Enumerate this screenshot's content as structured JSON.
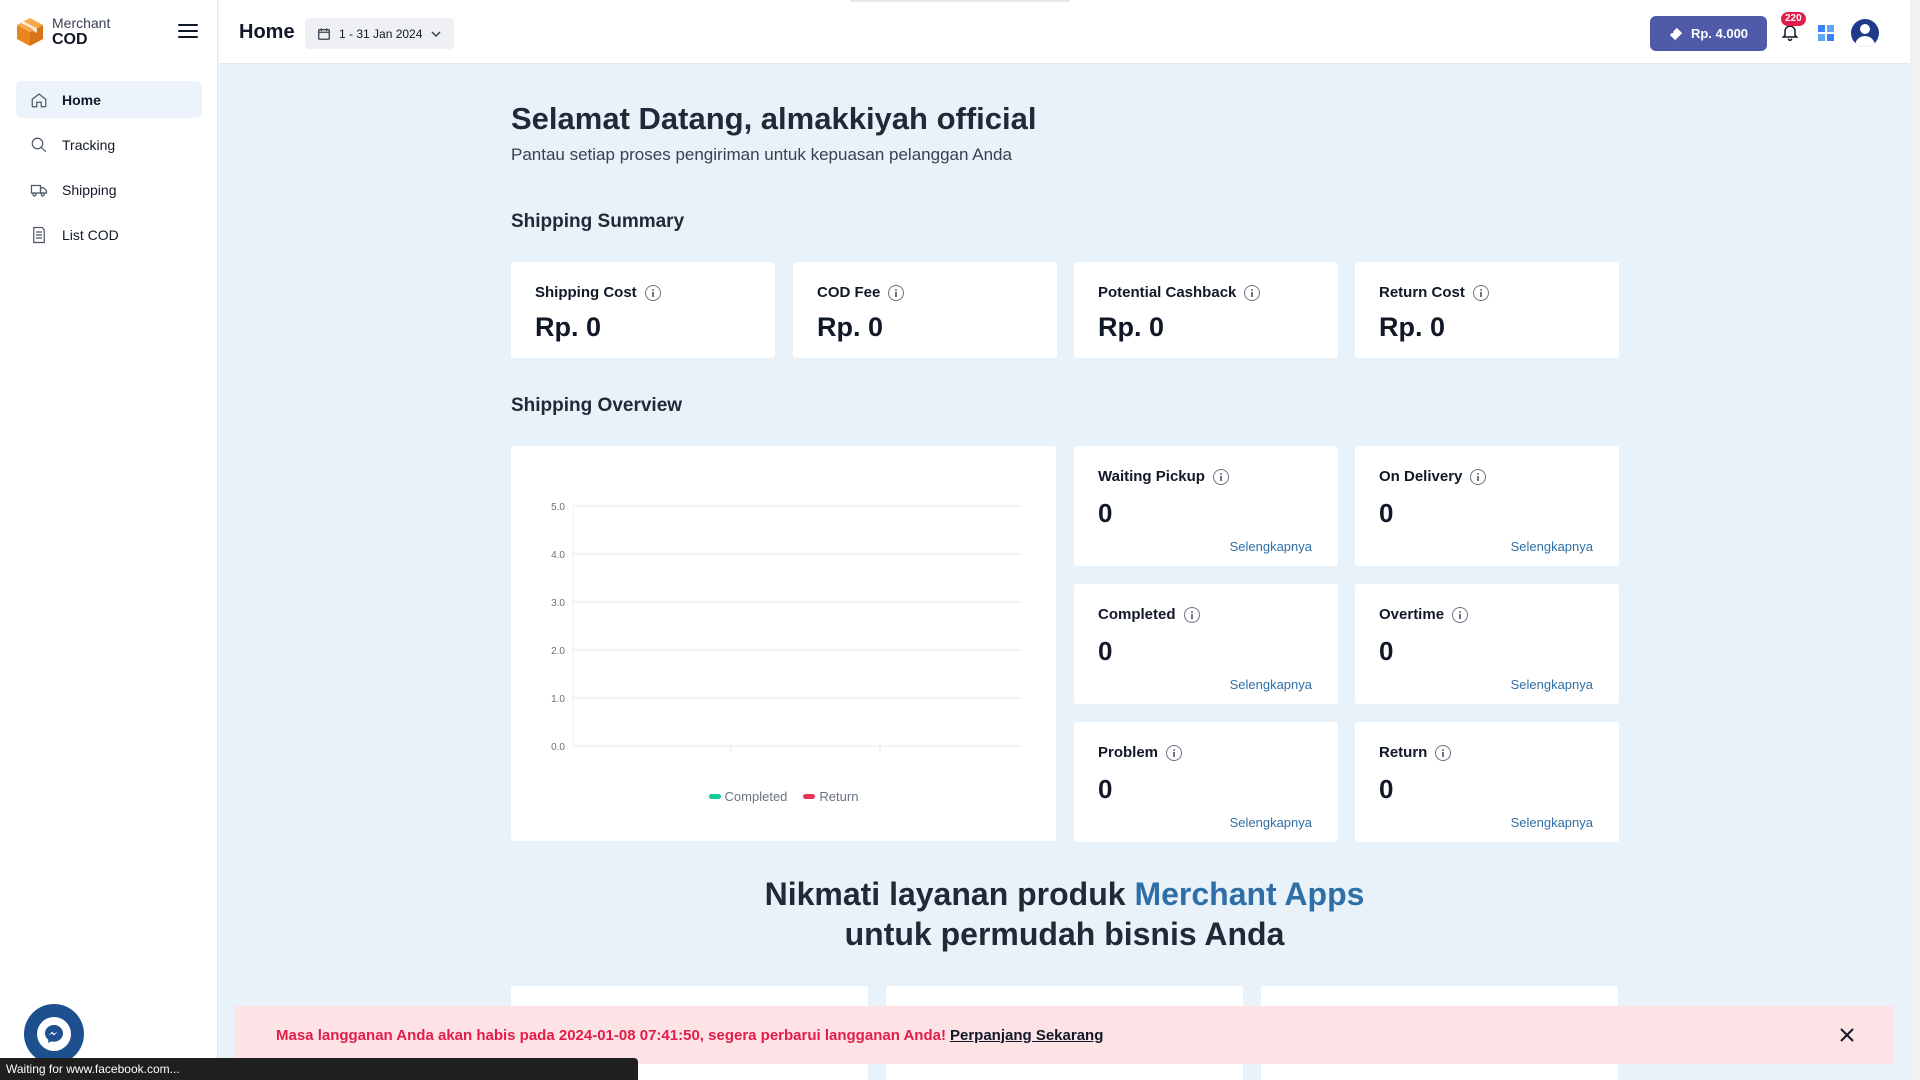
{
  "brand": {
    "top": "Merchant",
    "bottom": "COD"
  },
  "sidebar": {
    "items": [
      {
        "label": "Home",
        "icon": "home-icon"
      },
      {
        "label": "Tracking",
        "icon": "search-icon"
      },
      {
        "label": "Shipping",
        "icon": "truck-icon"
      },
      {
        "label": "List COD",
        "icon": "document-icon"
      }
    ]
  },
  "header": {
    "title": "Home",
    "date_range": "1 - 31 Jan 2024",
    "balance": "Rp. 4.000",
    "notification_count": "220"
  },
  "main": {
    "greeting": "Selamat Datang, almakkiyah official",
    "subgreeting": "Pantau setiap proses pengiriman untuk kepuasan pelanggan Anda",
    "summary_title": "Shipping Summary",
    "summary_cards": [
      {
        "label": "Shipping Cost",
        "value": "Rp. 0"
      },
      {
        "label": "COD Fee",
        "value": "Rp. 0"
      },
      {
        "label": "Potential Cashback",
        "value": "Rp. 0"
      },
      {
        "label": "Return Cost",
        "value": "Rp. 0"
      }
    ],
    "overview_title": "Shipping Overview",
    "overview_cards": [
      {
        "label": "Waiting Pickup",
        "value": "0",
        "link": "Selengkapnya"
      },
      {
        "label": "On Delivery",
        "value": "0",
        "link": "Selengkapnya"
      },
      {
        "label": "Completed",
        "value": "0",
        "link": "Selengkapnya"
      },
      {
        "label": "Overtime",
        "value": "0",
        "link": "Selengkapnya"
      },
      {
        "label": "Problem",
        "value": "0",
        "link": "Selengkapnya"
      },
      {
        "label": "Return",
        "value": "0",
        "link": "Selengkapnya"
      }
    ],
    "promo": {
      "line1_prefix": "Nikmati layanan produk",
      "line1_accent": "Merchant Apps",
      "line2": "untuk permudah bisnis Anda"
    }
  },
  "chart_data": {
    "type": "line",
    "y_ticks": [
      "5.0",
      "4.0",
      "3.0",
      "2.0",
      "1.0",
      "0.0"
    ],
    "ylim": [
      0,
      5
    ],
    "grid": true,
    "legend_position": "bottom",
    "series": [
      {
        "name": "Completed",
        "values": [],
        "color": "#10c998"
      },
      {
        "name": "Return",
        "values": [],
        "color": "#e8335c"
      }
    ]
  },
  "banner": {
    "message": "Masa langganan Anda akan habis pada 2024-01-08 07:41:50, segera perbarui langganan Anda!",
    "action": "Perpanjang Sekarang"
  },
  "statusbar": {
    "text": "Waiting for www.facebook.com..."
  },
  "colors": {
    "accent": "#4f5aa8",
    "link": "#2f6fa8",
    "banner_bg": "#fde2e6",
    "banner_text": "#e11d48"
  }
}
